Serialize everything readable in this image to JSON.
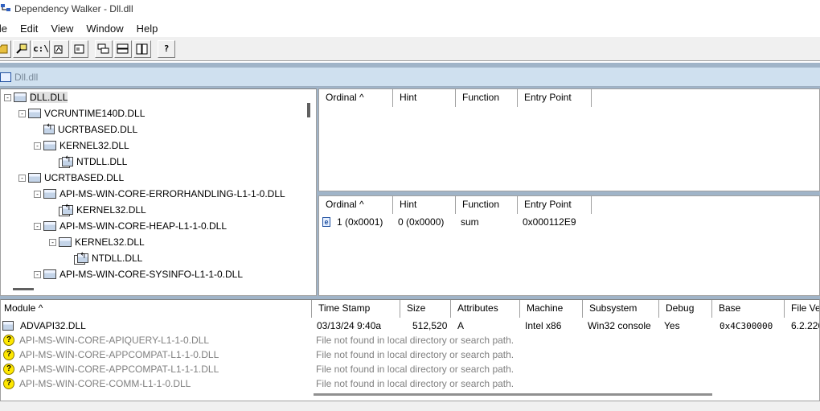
{
  "window": {
    "title": "Dependency Walker - Dll.dll",
    "child_title": "Dll.dll"
  },
  "menu": [
    "ile",
    "Edit",
    "View",
    "Window",
    "Help"
  ],
  "toolbar": {
    "console_label": "c:\\",
    "help_label": "?"
  },
  "tree": [
    {
      "label": "DLL.DLL",
      "depth": 0,
      "toggle": "-",
      "selected": true
    },
    {
      "label": "VCRUNTIME140D.DLL",
      "depth": 1,
      "toggle": "-"
    },
    {
      "label": "UCRTBASED.DLL",
      "depth": 2,
      "toggle": ""
    },
    {
      "label": "KERNEL32.DLL",
      "depth": 2,
      "toggle": "-"
    },
    {
      "label": "NTDLL.DLL",
      "depth": 3,
      "toggle": ""
    },
    {
      "label": "UCRTBASED.DLL",
      "depth": 1,
      "toggle": "-"
    },
    {
      "label": "API-MS-WIN-CORE-ERRORHANDLING-L1-1-0.DLL",
      "depth": 2,
      "toggle": "-"
    },
    {
      "label": "KERNEL32.DLL",
      "depth": 3,
      "toggle": ""
    },
    {
      "label": "API-MS-WIN-CORE-HEAP-L1-1-0.DLL",
      "depth": 2,
      "toggle": "-"
    },
    {
      "label": "KERNEL32.DLL",
      "depth": 3,
      "toggle": "-"
    },
    {
      "label": "NTDLL.DLL",
      "depth": 4,
      "toggle": ""
    },
    {
      "label": "API-MS-WIN-CORE-SYSINFO-L1-1-0.DLL",
      "depth": 2,
      "toggle": "-"
    }
  ],
  "imports": {
    "columns": [
      "Ordinal ^",
      "Hint",
      "Function",
      "Entry Point"
    ]
  },
  "exports": {
    "columns": [
      "Ordinal ^",
      "Hint",
      "Function",
      "Entry Point"
    ],
    "rows": [
      {
        "icon": "e",
        "ordinal": "1  (0x0001)",
        "hint": "0  (0x0000)",
        "function": "sum",
        "entry_point": "0x000112E9"
      }
    ]
  },
  "modules": {
    "columns": [
      "Module ^",
      "Time Stamp",
      "Size",
      "Attributes",
      "Machine",
      "Subsystem",
      "Debug",
      "Base",
      "File Ve"
    ],
    "rows": [
      {
        "module": "ADVAPI32.DLL",
        "timestamp": "03/13/24    9:40a",
        "size": "512,520",
        "attributes": "A",
        "machine": "Intel x86",
        "subsystem": "Win32 console",
        "debug": "Yes",
        "base": "0x4C300000",
        "file_version": "6.2.226"
      },
      {
        "module": "API-MS-WIN-CORE-APIQUERY-L1-1-0.DLL",
        "error": "File not found in local directory or search path."
      },
      {
        "module": "API-MS-WIN-CORE-APPCOMPAT-L1-1-0.DLL",
        "error": "File not found in local directory or search path."
      },
      {
        "module": "API-MS-WIN-CORE-APPCOMPAT-L1-1-1.DLL",
        "error": "File not found in local directory or search path."
      },
      {
        "module": "API-MS-WIN-CORE-COMM-L1-1-0.DLL",
        "error": "File not found in local directory or search path."
      }
    ]
  }
}
